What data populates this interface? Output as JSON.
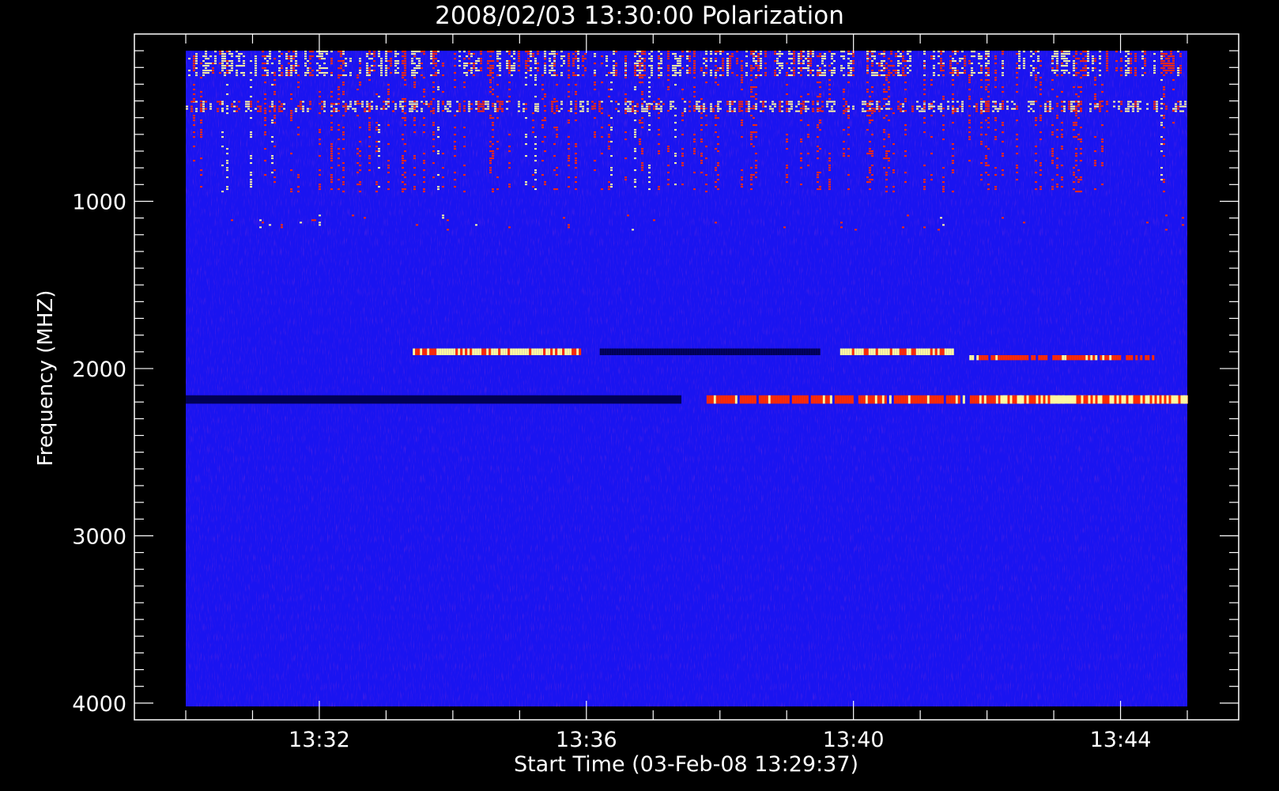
{
  "chart_data": {
    "type": "heatmap",
    "title": "2008/02/03 13:30:00 Polarization",
    "xlabel": "Start Time (03-Feb-08 13:29:37)",
    "ylabel": "Frequency (MHZ)",
    "x_tick_labels": [
      "13:32",
      "13:36",
      "13:40",
      "13:44"
    ],
    "x_tick_values_min": [
      2,
      6,
      10,
      14
    ],
    "xlim_min": [
      0,
      15
    ],
    "y_tick_labels": [
      "1000",
      "2000",
      "3000",
      "4000"
    ],
    "y_tick_values": [
      1000,
      2000,
      3000,
      4000
    ],
    "ylim": [
      0,
      4100
    ],
    "ylim_data": [
      100,
      4020
    ],
    "y_inverted": true,
    "grid": false,
    "colormap": {
      "background": "#000000",
      "base": "#1a14f0",
      "low": "#000055",
      "mid": "#ff2a00",
      "high": "#fff8a0"
    },
    "features": [
      {
        "name": "rfi-band-top",
        "f_min": 100,
        "f_max": 250,
        "t_start": 0,
        "t_end": 15,
        "level": "high",
        "density": 0.55
      },
      {
        "name": "rfi-band-upper",
        "f_min": 400,
        "f_max": 470,
        "t_start": 0,
        "t_end": 15,
        "level": "high",
        "density": 0.6
      },
      {
        "name": "rfi-speckle-top",
        "f_min": 100,
        "f_max": 950,
        "t_start": 0,
        "t_end": 15,
        "level": "mid",
        "density": 0.25
      },
      {
        "name": "rfi-band-mid",
        "f_min": 1080,
        "f_max": 1180,
        "t_start": 0,
        "t_end": 15,
        "level": "mid",
        "density": 0.12
      },
      {
        "name": "emission-1910-a",
        "f_min": 1880,
        "f_max": 1920,
        "t_start": 3.4,
        "t_end": 5.9,
        "level": "high",
        "density": 1
      },
      {
        "name": "absorption-1910",
        "f_min": 1880,
        "f_max": 1920,
        "t_start": 6.2,
        "t_end": 9.5,
        "level": "low",
        "density": 1
      },
      {
        "name": "emission-1910-b",
        "f_min": 1880,
        "f_max": 1920,
        "t_start": 9.8,
        "t_end": 11.5,
        "level": "high",
        "density": 1
      },
      {
        "name": "emission-1930",
        "f_min": 1920,
        "f_max": 1950,
        "t_start": 11.7,
        "t_end": 14.5,
        "level": "mid",
        "density": 0.8
      },
      {
        "name": "absorption-2180",
        "f_min": 2160,
        "f_max": 2210,
        "t_start": 0,
        "t_end": 7.4,
        "level": "low",
        "density": 1
      },
      {
        "name": "emission-2180",
        "f_min": 2160,
        "f_max": 2210,
        "t_start": 7.8,
        "t_end": 15,
        "level": "mid",
        "density": 0.9
      },
      {
        "name": "emission-2180-peak",
        "f_min": 2160,
        "f_max": 2210,
        "t_start": 12.2,
        "t_end": 15,
        "level": "high",
        "density": 1
      }
    ]
  }
}
